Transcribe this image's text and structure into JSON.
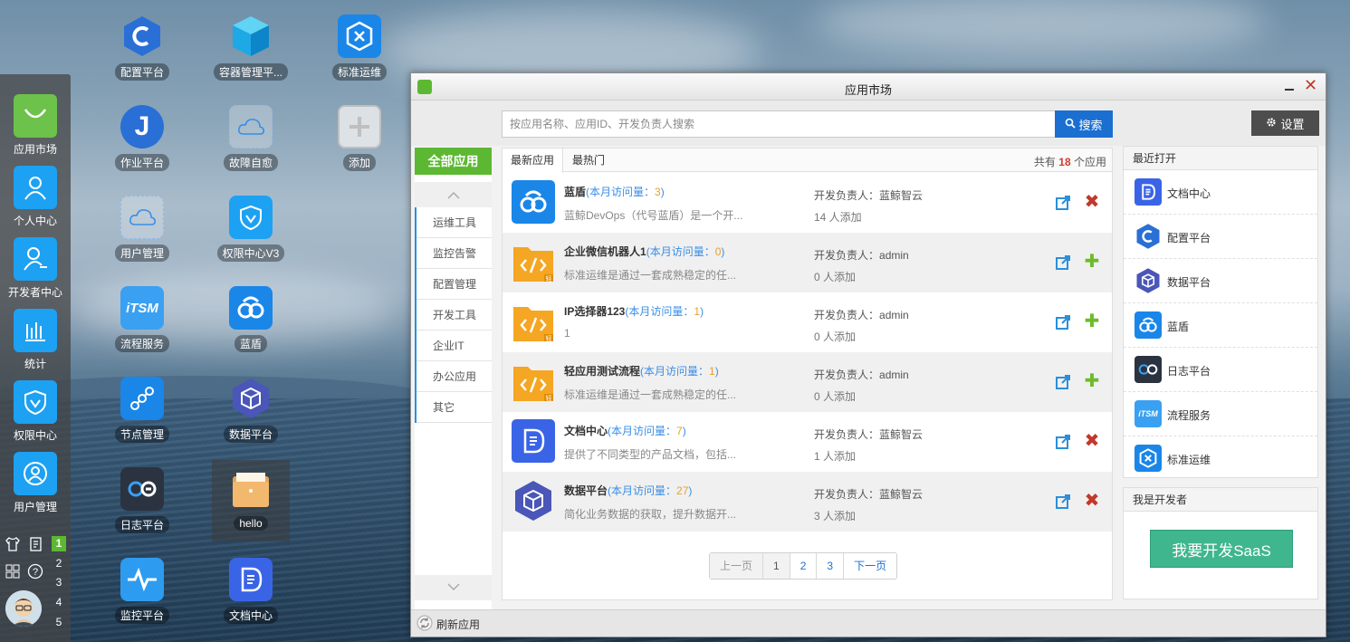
{
  "colors": {
    "accent_green": "#5cb832",
    "search_blue": "#1a6fd1",
    "saas_green": "#3fb68e",
    "remove_red": "#c0392b",
    "add_green": "#6dbb2b"
  },
  "dock": {
    "items": [
      {
        "label": "应用市场",
        "icon": "shopping-bag-icon",
        "color": "#6cc24a"
      },
      {
        "label": "个人中心",
        "icon": "person-icon",
        "color": "#1da1f2"
      },
      {
        "label": "开发者中心",
        "icon": "developer-icon",
        "color": "#1da1f2"
      },
      {
        "label": "统计",
        "icon": "bar-chart-icon",
        "color": "#1da1f2"
      },
      {
        "label": "权限中心",
        "icon": "shield-icon",
        "color": "#1da1f2"
      },
      {
        "label": "用户管理",
        "icon": "user-circle-icon",
        "color": "#1da1f2"
      }
    ],
    "workspaces": [
      "1",
      "2",
      "3",
      "4",
      "5"
    ],
    "active_workspace": "1"
  },
  "desktop": {
    "icons": [
      {
        "label": "配置平台",
        "icon": "config-hexagon-icon"
      },
      {
        "label": "容器管理平...",
        "icon": "cube-icon"
      },
      {
        "label": "标准运维",
        "icon": "ops-gear-icon"
      },
      {
        "label": "作业平台",
        "icon": "job-j-icon"
      },
      {
        "label": "故障自愈",
        "icon": "cloud-outline-icon"
      },
      {
        "label": "添加",
        "icon": "plus-icon"
      },
      {
        "label": "用户管理",
        "icon": "cloud-outline-icon"
      },
      {
        "label": "权限中心V3",
        "icon": "shield-icon"
      },
      {
        "label": "流程服务",
        "icon": "itsm-icon"
      },
      {
        "label": "蓝盾",
        "icon": "bluekingdevops-icon"
      },
      {
        "label": "节点管理",
        "icon": "node-graph-icon"
      },
      {
        "label": "数据平台",
        "icon": "data-cube-icon"
      },
      {
        "label": "日志平台",
        "icon": "log-infinity-icon"
      },
      {
        "label": "hello",
        "icon": "folder-icon"
      },
      {
        "label": "监控平台",
        "icon": "pulse-icon"
      },
      {
        "label": "文档中心",
        "icon": "document-icon"
      }
    ]
  },
  "window": {
    "title": "应用市场",
    "search_placeholder": "按应用名称、应用ID、开发负责人搜索",
    "search_label": "搜索",
    "settings_label": "设置",
    "categories": {
      "all_label": "全部应用",
      "items": [
        "运维工具",
        "监控告警",
        "配置管理",
        "开发工具",
        "企业IT",
        "办公应用",
        "其它"
      ]
    },
    "tabs": [
      "最新应用",
      "最热门"
    ],
    "total_prefix": "共有",
    "total_count": "18",
    "total_suffix": "个应用",
    "visits_label": "本月访问量：",
    "owner_label": "开发负责人：",
    "apps": [
      {
        "name": "蓝盾",
        "visits": "3",
        "desc": "蓝鲸DevOps（代号蓝盾）是一个开...",
        "owner": "蓝鲸智云",
        "added": "14 人添加",
        "action": "remove",
        "icon": "bluekingdevops-icon"
      },
      {
        "name": "企业微信机器人1",
        "visits": "0",
        "desc": "标准运维是通过一套成熟稳定的任...",
        "owner": "admin",
        "added": "0 人添加",
        "action": "add",
        "icon": "code-folder-icon"
      },
      {
        "name": "IP选择器123",
        "visits": "1",
        "desc": "1",
        "owner": "admin",
        "added": "0 人添加",
        "action": "add",
        "icon": "code-folder-icon"
      },
      {
        "name": "轻应用测试流程",
        "visits": "1",
        "desc": "标准运维是通过一套成熟稳定的任...",
        "owner": "admin",
        "added": "0 人添加",
        "action": "add",
        "icon": "code-folder-icon"
      },
      {
        "name": "文档中心",
        "visits": "7",
        "desc": "提供了不同类型的产品文档，包括...",
        "owner": "蓝鲸智云",
        "added": "1 人添加",
        "action": "remove",
        "icon": "document-icon"
      },
      {
        "name": "数据平台",
        "visits": "27",
        "desc": "简化业务数据的获取，提升数据开...",
        "owner": "蓝鲸智云",
        "added": "3 人添加",
        "action": "remove",
        "icon": "data-cube-icon"
      }
    ],
    "pager": {
      "prev": "上一页",
      "pages": [
        "1",
        "2",
        "3"
      ],
      "next": "下一页"
    },
    "recent": {
      "title": "最近打开",
      "items": [
        {
          "label": "文档中心",
          "icon": "document-icon"
        },
        {
          "label": "配置平台",
          "icon": "config-hexagon-icon"
        },
        {
          "label": "数据平台",
          "icon": "data-cube-icon"
        },
        {
          "label": "蓝盾",
          "icon": "bluekingdevops-icon"
        },
        {
          "label": "日志平台",
          "icon": "log-infinity-icon"
        },
        {
          "label": "流程服务",
          "icon": "itsm-icon"
        },
        {
          "label": "标准运维",
          "icon": "ops-gear-icon"
        }
      ]
    },
    "developer": {
      "title": "我是开发者",
      "button": "我要开发SaaS"
    },
    "refresh_label": "刷新应用"
  }
}
